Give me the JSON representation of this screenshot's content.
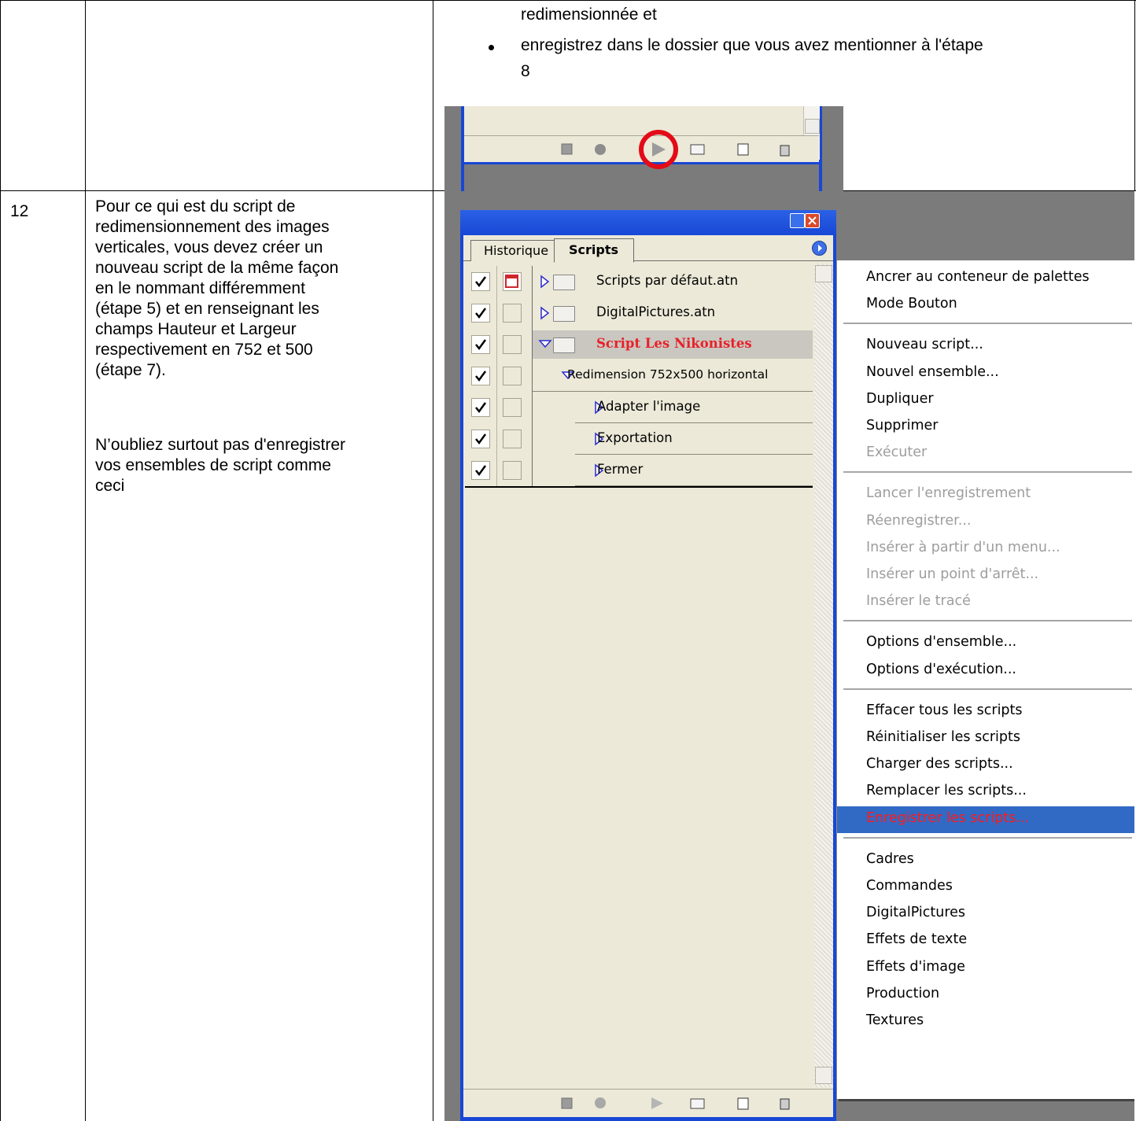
{
  "top_row": {
    "instruction_lines": [
      "redimensionnée et",
      "enregistrez dans le dossier que vous avez mentionner à l'étape",
      "8"
    ]
  },
  "step_row": {
    "number": "12",
    "paragraph1": [
      "Pour ce qui est du script de",
      "redimensionnement des images",
      "verticales, vous devez créer un",
      "nouveau script de la même façon",
      "en le nommant différemment",
      "(étape 5) et en renseignant les",
      "champs Hauteur et Largeur",
      "respectivement en 752 et 500",
      "(étape 7)."
    ],
    "paragraph2": [
      "N’oubliez surtout pas d'enregistrer",
      "vos ensembles de script comme",
      "ceci"
    ]
  },
  "panel": {
    "tabs": [
      "Historique",
      "Scripts"
    ],
    "active_tab": "Scripts",
    "rows": [
      {
        "label": "Scripts par défaut.atn",
        "kind": "set",
        "expanded": false
      },
      {
        "label": "DigitalPictures.atn",
        "kind": "set",
        "expanded": false
      },
      {
        "label": "Script Les Nikonistes",
        "kind": "set",
        "expanded": true,
        "selected": true
      },
      {
        "label": "Redimension 752x500 horizontal",
        "kind": "action",
        "expanded": true
      },
      {
        "label": "Adapter l'image",
        "kind": "command"
      },
      {
        "label": "Exportation",
        "kind": "command"
      },
      {
        "label": "Fermer",
        "kind": "command"
      }
    ],
    "toolbar_icons": [
      "stop-icon",
      "record-icon",
      "play-icon",
      "new-set-icon",
      "new-action-icon",
      "delete-icon"
    ]
  },
  "menu": {
    "groups": [
      [
        {
          "label": "Ancrer au conteneur de palettes",
          "enabled": true
        },
        {
          "label": "Mode Bouton",
          "enabled": true
        }
      ],
      [
        {
          "label": "Nouveau script...",
          "enabled": true
        },
        {
          "label": "Nouvel ensemble...",
          "enabled": true
        },
        {
          "label": "Dupliquer",
          "enabled": true
        },
        {
          "label": "Supprimer",
          "enabled": true
        },
        {
          "label": "Exécuter",
          "enabled": false
        }
      ],
      [
        {
          "label": "Lancer l'enregistrement",
          "enabled": false
        },
        {
          "label": "Réenregistrer...",
          "enabled": false
        },
        {
          "label": "Insérer à partir d'un menu...",
          "enabled": false
        },
        {
          "label": "Insérer un point d'arrêt...",
          "enabled": false
        },
        {
          "label": "Insérer le tracé",
          "enabled": false
        }
      ],
      [
        {
          "label": "Options d'ensemble...",
          "enabled": true
        },
        {
          "label": "Options d'exécution...",
          "enabled": true
        }
      ],
      [
        {
          "label": "Effacer tous les scripts",
          "enabled": true
        },
        {
          "label": "Réinitialiser les scripts",
          "enabled": true
        },
        {
          "label": "Charger des scripts...",
          "enabled": true
        },
        {
          "label": "Remplacer les scripts...",
          "enabled": true
        },
        {
          "label": "Enregistrer les scripts...",
          "enabled": true,
          "highlighted": true
        }
      ],
      [
        {
          "label": "Cadres",
          "enabled": true
        },
        {
          "label": "Commandes",
          "enabled": true
        },
        {
          "label": "DigitalPictures",
          "enabled": true
        },
        {
          "label": "Effets de texte",
          "enabled": true
        },
        {
          "label": "Effets d'image",
          "enabled": true
        },
        {
          "label": "Production",
          "enabled": true
        },
        {
          "label": "Textures",
          "enabled": true
        }
      ]
    ]
  },
  "colors": {
    "highlight_bg": "#316ac5",
    "highlight_text": "#ff1a1a",
    "selected_set_text": "#e8212a",
    "frame_blue": "#1847d6",
    "panel_bg": "#ece9d8",
    "screenshot_gray": "#7b7b7b",
    "annotation_circle": "#e30b17"
  }
}
